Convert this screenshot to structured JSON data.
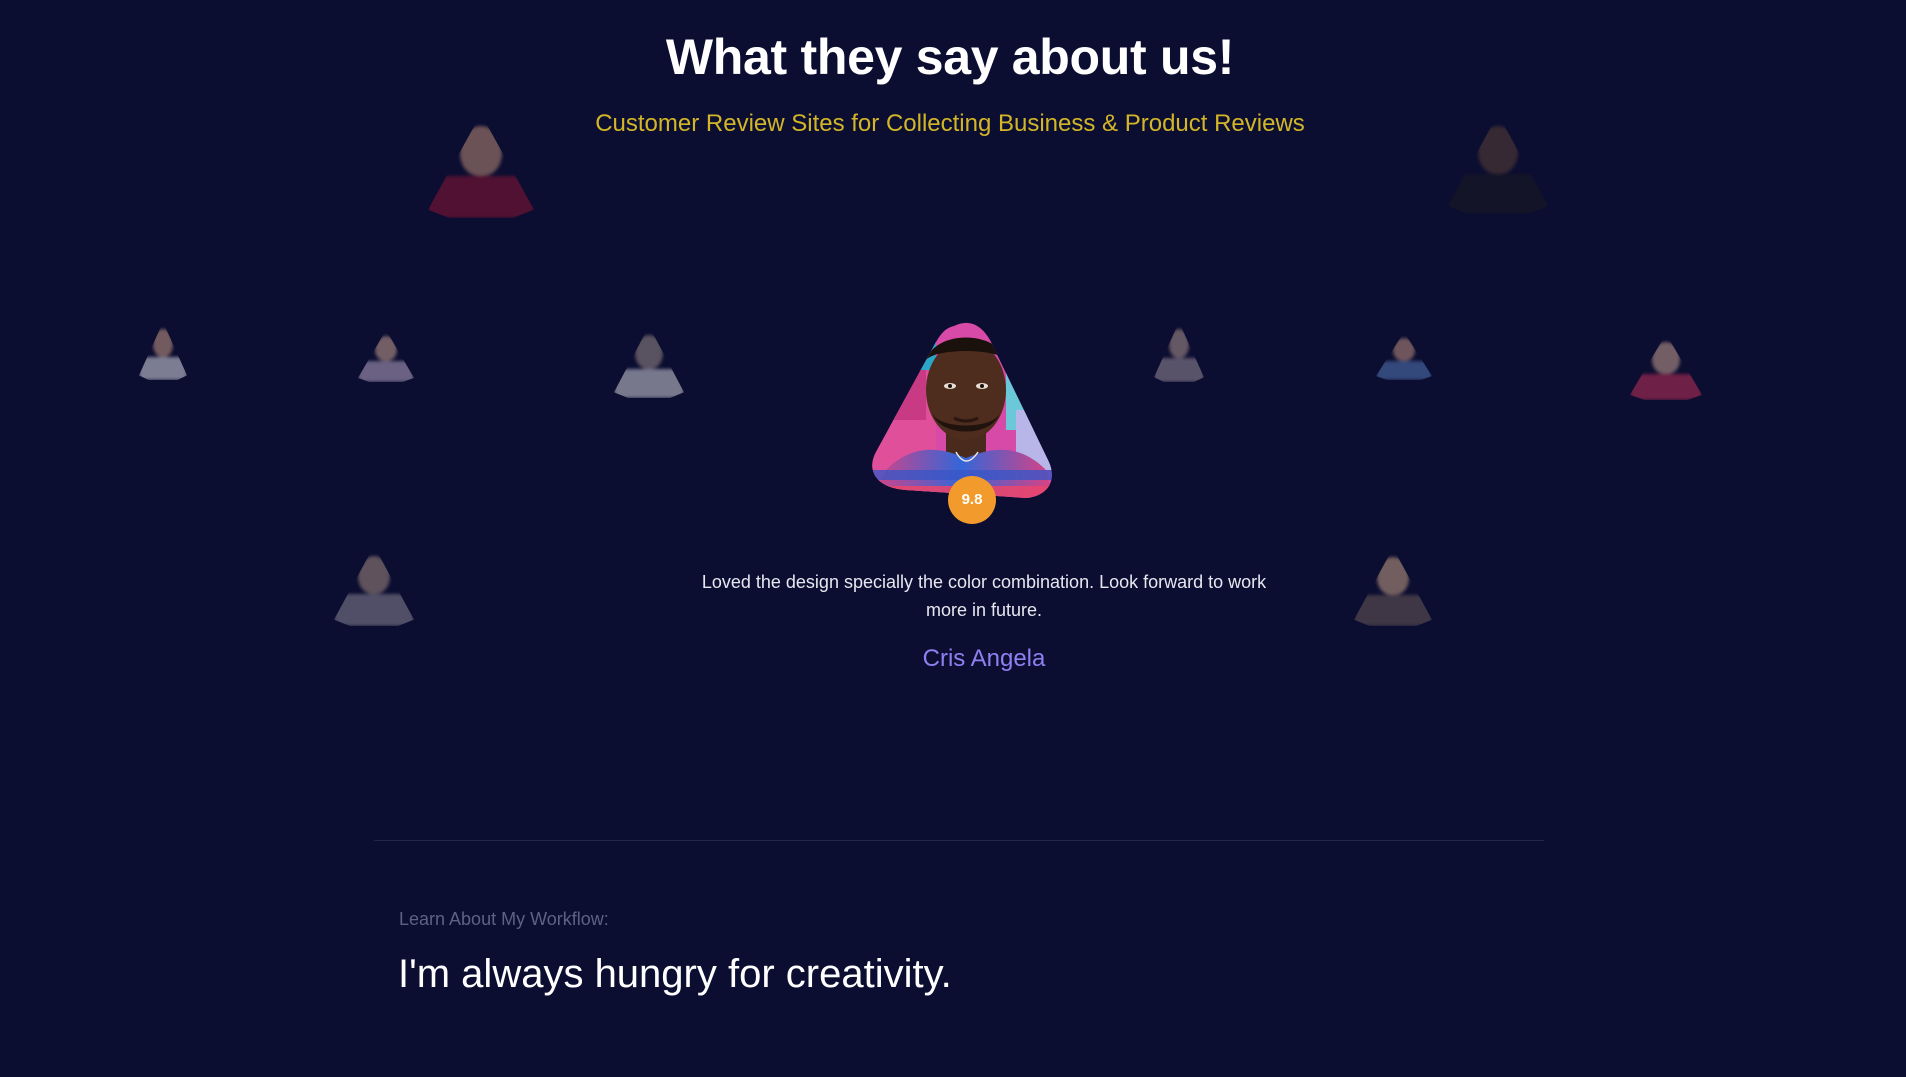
{
  "section": {
    "title": "What they say about us!",
    "subtitle": "Customer Review Sites for Collecting Business & Product Reviews"
  },
  "featured_review": {
    "avatar": "reviewer-photo",
    "rating": "9.8",
    "quote": "Loved the design specially the color combination. Look forward to work more in future.",
    "name": "Cris Angela"
  },
  "workflow": {
    "label": "Learn About My Workflow:",
    "title": "I'm always hungry for creativity."
  },
  "colors": {
    "background": "#0c0e31",
    "subtitle": "#d2b628",
    "badge": "#f29b2c",
    "reviewer_name": "#8c80f2"
  }
}
